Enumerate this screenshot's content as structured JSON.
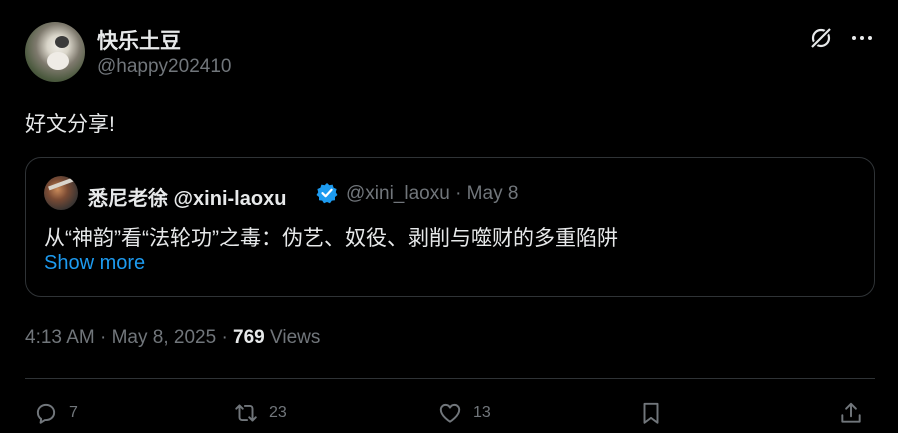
{
  "post": {
    "author": {
      "display_name": "快乐土豆",
      "handle": "@happy202410"
    },
    "text": "好文分享!",
    "quoted": {
      "display_name": "悉尼老徐 @xini-laoxu",
      "handle_date": "@xini_laoxu · May 8",
      "text": "从“神韵”看“法轮功”之毒：伪艺、奴役、剥削与噬财的多重陷阱",
      "show_more": "Show more"
    },
    "meta": {
      "timestamp": "4:13 AM · May 8, 2025 · ",
      "views_count": "769",
      "views_label": " Views"
    }
  },
  "actions": {
    "replies": "7",
    "reposts": "23",
    "likes": "13"
  },
  "icons": {
    "top_right": [
      "grok-icon",
      "more-icon"
    ],
    "actions": [
      "reply-icon",
      "repost-icon",
      "like-icon",
      "bookmark-icon",
      "share-icon"
    ]
  },
  "colors": {
    "background": "#000000",
    "primary_text": "#e7e9ea",
    "secondary_text": "#71767b",
    "link": "#1d9bf0",
    "border": "#2f3336",
    "verified": "#1d9bf0"
  }
}
